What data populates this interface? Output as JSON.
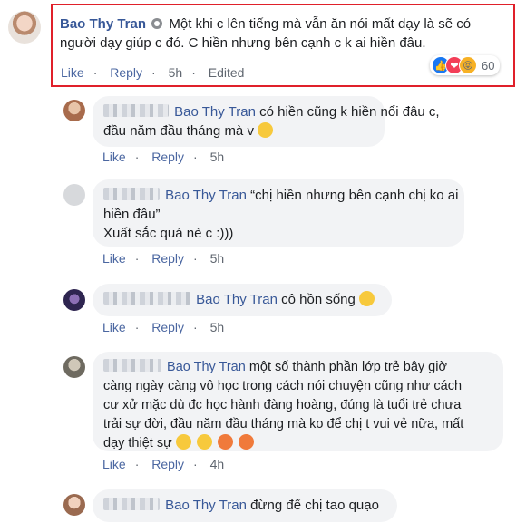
{
  "main_comment": {
    "author": "Bao Thy Tran",
    "text_line1": "Một khi c lên tiếng mà vẫn ăn nói mất dạy là sẽ có",
    "text_line2": "người dạy giúp c đó. C hiền nhưng bên cạnh c k ai hiền đâu.",
    "actions": {
      "like": "Like",
      "reply": "Reply",
      "time": "5h",
      "edited": "Edited"
    },
    "reaction_count": "60",
    "reaction_icons": [
      "like-icon",
      "love-icon",
      "haha-icon"
    ],
    "highlight_color": "#e0202a"
  },
  "replies": [
    {
      "author": "Bao Thy Tran",
      "lines": [
        "có hiền cũng k hiền nổi đâu c,",
        "đầu năm đầu tháng mà v"
      ],
      "emoji": [
        "sad-face-emoji"
      ],
      "actions": {
        "like": "Like",
        "reply": "Reply",
        "time": "5h"
      }
    },
    {
      "author": "Bao Thy Tran",
      "lines": [
        "“chị hiền nhưng bên cạnh chị ko ai",
        "hiền đâu”",
        "Xuất sắc quá nè c :)))"
      ],
      "actions": {
        "like": "Like",
        "reply": "Reply",
        "time": "5h"
      }
    },
    {
      "author": "Bao Thy Tran",
      "lines": [
        "cô hồn sống"
      ],
      "emoji": [
        "laughing-face-emoji"
      ],
      "actions": {
        "like": "Like",
        "reply": "Reply",
        "time": "5h"
      }
    },
    {
      "author": "Bao Thy Tran",
      "lines": [
        "một số thành phần lớp trẻ bây giờ",
        "càng ngày càng vô học trong cách nói chuyện cũng như cách",
        "cư xử mặc dù đc học hành đàng hoàng, đúng là tuổi trẻ chưa",
        "trải sự đời, đầu năm đầu tháng mà ko để chị t vui vẻ nữa, mất",
        "dạy thiệt sự"
      ],
      "emoji": [
        "steaming-face-emoji",
        "steaming-face-emoji",
        "angry-face-emoji",
        "angry-face-emoji"
      ],
      "actions": {
        "like": "Like",
        "reply": "Reply",
        "time": "4h"
      }
    },
    {
      "author": "Bao Thy Tran",
      "lines": [
        "đừng để chị tao quạo"
      ]
    }
  ]
}
